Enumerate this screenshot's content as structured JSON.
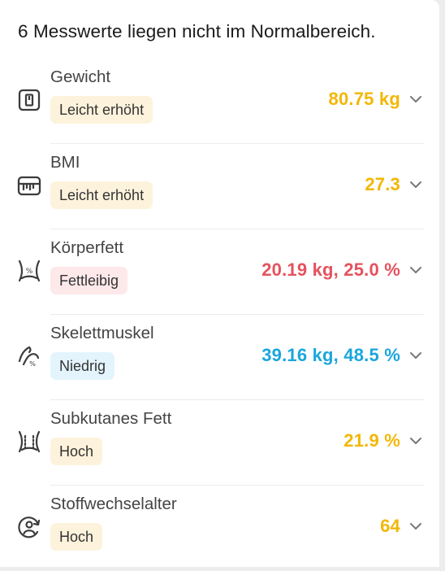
{
  "header": {
    "title": "6 Messwerte liegen nicht im Normalbereich."
  },
  "colors": {
    "yellow": "#f2b705",
    "red": "#e4525e",
    "blue": "#1aa6dc",
    "badge_yellow_bg": "#fdf3dc",
    "badge_red_bg": "#fde8ea",
    "badge_blue_bg": "#e3f4fd"
  },
  "metrics": [
    {
      "name": "Gewicht",
      "status": "Leicht erhöht",
      "value": "80.75 kg",
      "icon": "scale-icon"
    },
    {
      "name": "BMI",
      "status": "Leicht erhöht",
      "value": "27.3",
      "icon": "ruler-icon"
    },
    {
      "name": "Körperfett",
      "status": "Fettleibig",
      "value": "20.19 kg, 25.0 %",
      "icon": "body-fat-icon"
    },
    {
      "name": "Skelettmuskel",
      "status": "Niedrig",
      "value": "39.16 kg, 48.5 %",
      "icon": "muscle-icon"
    },
    {
      "name": "Subkutanes Fett",
      "status": "Hoch",
      "value": "21.9 %",
      "icon": "subcutaneous-fat-icon"
    },
    {
      "name": "Stoffwechselalter",
      "status": "Hoch",
      "value": "64",
      "icon": "metabolic-age-icon"
    }
  ]
}
